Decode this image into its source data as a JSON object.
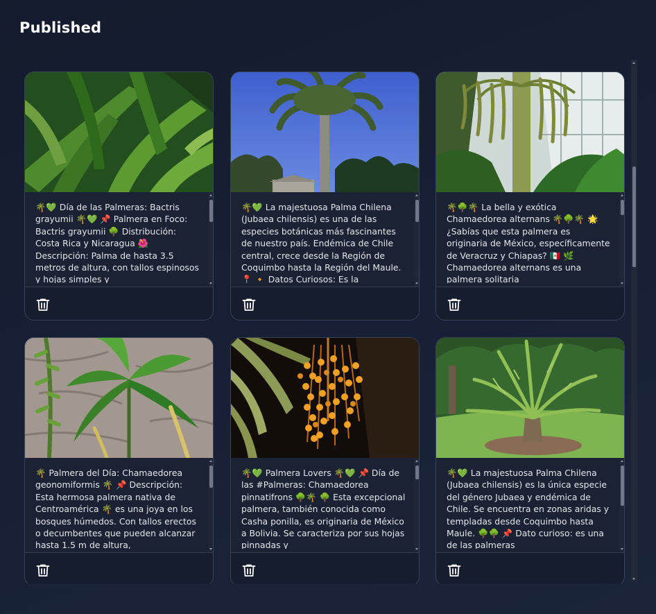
{
  "page": {
    "title": "Published"
  },
  "icons": {
    "delete": "trash-icon"
  },
  "cards": [
    {
      "image": "bactris-grayumii-leaves-photo",
      "caption": "🌴💚 Día de las Palmeras: Bactris grayumii 🌴💚 📌 Palmera en Foco: Bactris grayumii 🌳 Distribución: Costa Rica y Nicaragua 🌺 Descripción: Palma de hasta 3.5 metros de altura, con tallos espinosos y hojas simples y"
    },
    {
      "image": "palma-chilena-photo",
      "caption": "🌴💚 La majestuosa Palma Chilena (Jubaea chilensis) es una de las especies botánicas más fascinantes de nuestro país. Endémica de Chile central, crece desde la Región de Coquimbo hasta la Región del Maule. 📍 🔸 Datos Curiosos: Es la"
    },
    {
      "image": "chamaedorea-alternans-photo",
      "caption": "🌴🌳🌴 La bella y exótica Chamaedorea alternans 🌴🌳🌴 🌟 ¿Sabías que esta palmera es originaria de México, específicamente de Veracruz y Chiapas? 🇲🇽 🌿 Chamaedorea alternans es una palmera solitaria"
    },
    {
      "image": "chamaedorea-geonomiformis-photo",
      "caption": "🌴 Palmera del Día: Chamaedorea geonomiformis 🌴 📌 Descripción: Esta hermosa palmera nativa de Centroamérica 🌴 es una joya en los bosques húmedos. Con tallos erectos o decumbentes que pueden alcanzar hasta 1.5 m de altura,"
    },
    {
      "image": "chamaedorea-pinnatifrons-fruits-photo",
      "caption": "🌴💚 Palmera Lovers 🌴💚 📌 Día de las #Palmeras: Chamaedorea pinnatifrons 🌳🌴 🌳 Esta excepcional palmera, también conocida como Casha ponilla, es originaria de México a Bolivia. Se caracteriza por sus hojas pinnadas y"
    },
    {
      "image": "jubaea-chilensis-garden-photo",
      "caption": "🌴💚 La majestuosa Palma Chilena (Jubaea chilensis) es la única especie del género Jubaea y endémica de Chile. Se encuentra en zonas aridas y templadas desde Coquimbo hasta Maule. 🌳🌳 📌 Dato curioso: es una de las palmeras"
    }
  ]
}
